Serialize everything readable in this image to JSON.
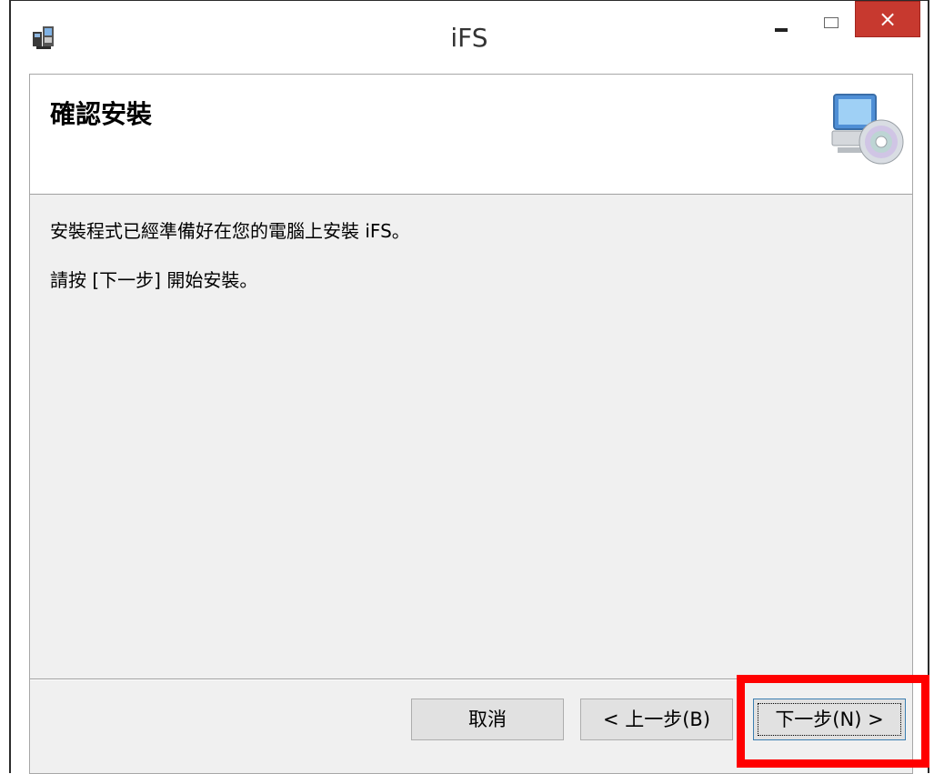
{
  "window": {
    "title": "iFS",
    "close_label": "×"
  },
  "header": {
    "title": "確認安裝",
    "graphic_icon": "computer-cd-icon"
  },
  "body": {
    "line1": "安裝程式已經準備好在您的電腦上安裝 iFS。",
    "line2": "請按 [下一步] 開始安裝。"
  },
  "buttons": {
    "cancel": "取消",
    "back": "< 上一步(B)",
    "next": "下一步(N) >"
  },
  "colors": {
    "close_button": "#c7392f",
    "highlight": "#ff0000",
    "dialog_bg": "#f0f0f0"
  }
}
